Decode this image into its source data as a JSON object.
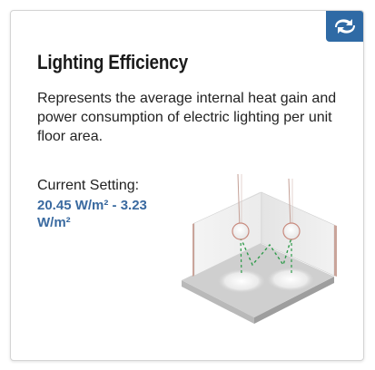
{
  "card": {
    "title": "Lighting Efficiency",
    "description": "Represents the average internal heat gain and power consumption of electric lighting per unit floor area.",
    "current_setting_label": "Current Setting:",
    "current_setting_value": "20.45 W/m² - 3.23 W/m²"
  },
  "colors": {
    "accent": "#2f6aa5",
    "value_text": "#3a6aa0",
    "light_path": "#2e9b4a"
  },
  "icons": {
    "corner_button": "link-swap-icon",
    "illustration": "room-lighting-illustration"
  }
}
